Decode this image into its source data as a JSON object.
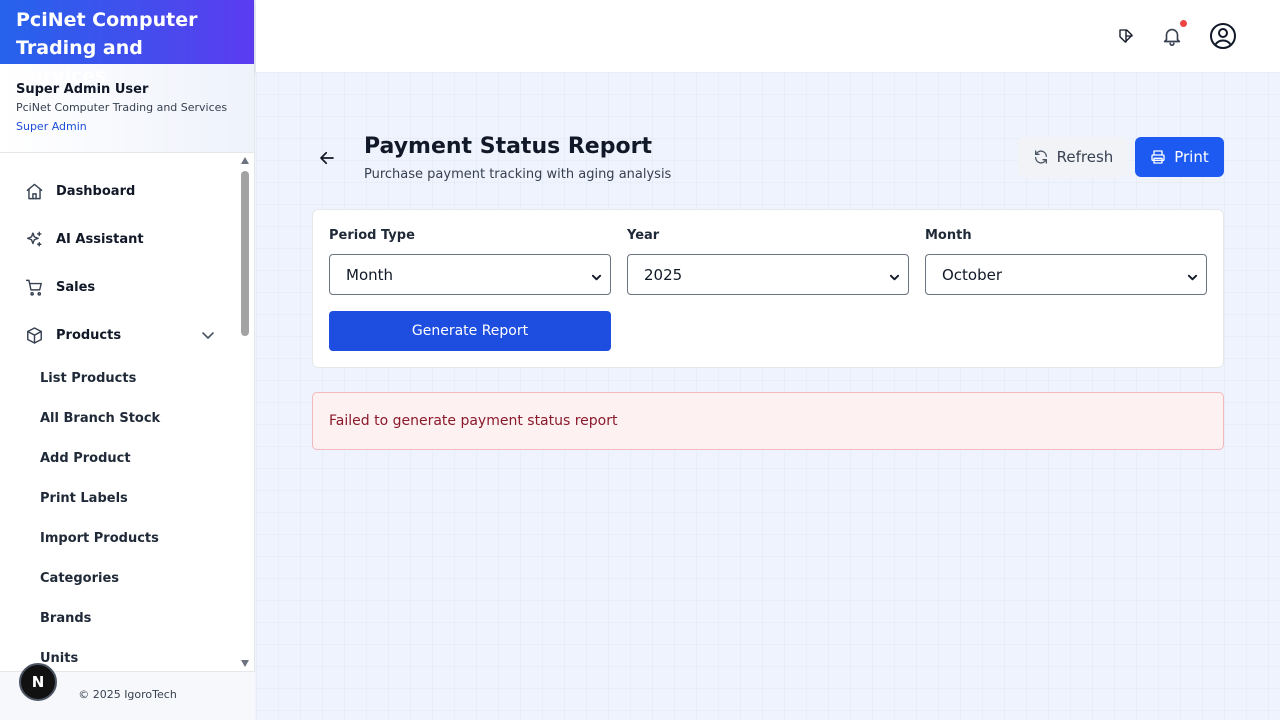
{
  "sidebar": {
    "brand_line1": "PciNet Computer",
    "brand_line2": "Trading and Services",
    "user": {
      "name": "Super Admin User",
      "company": "PciNet Computer Trading and Services",
      "role": "Super Admin"
    },
    "nav": [
      {
        "label": "Dashboard",
        "icon": "home-icon"
      },
      {
        "label": "AI Assistant",
        "icon": "sparkles-icon"
      },
      {
        "label": "Sales",
        "icon": "cart-icon"
      },
      {
        "label": "Products",
        "icon": "box-icon",
        "expanded": true
      }
    ],
    "products_submenu": [
      "List Products",
      "All Branch Stock",
      "Add Product",
      "Print Labels",
      "Import Products",
      "Categories",
      "Brands",
      "Units"
    ],
    "footer": "© 2025 IgoroTech",
    "badge": "N"
  },
  "topbar": {
    "icons": [
      "theme-toggle-icon",
      "bell-icon",
      "user-circle-icon"
    ],
    "notification_color": "#ef4444"
  },
  "page": {
    "title": "Payment Status Report",
    "subtitle": "Purchase payment tracking with aging analysis",
    "refresh_label": "Refresh",
    "print_label": "Print"
  },
  "filters": {
    "period_type": {
      "label": "Period Type",
      "value": "Month"
    },
    "year": {
      "label": "Year",
      "value": "2025"
    },
    "month": {
      "label": "Month",
      "value": "October"
    },
    "generate_label": "Generate Report"
  },
  "error": {
    "message": "Failed to generate payment status report"
  },
  "colors": {
    "accent": "#1d5af2",
    "brand_gradient_start": "#2563eb",
    "brand_gradient_end": "#5b3cf0",
    "error_bg": "#fdf1f2",
    "error_text": "#8b1a2b"
  }
}
